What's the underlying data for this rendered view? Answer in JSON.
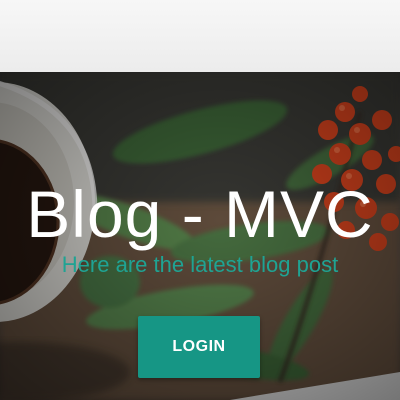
{
  "hero": {
    "title": "Blog - MVC",
    "subtitle": "Here are the latest blog post",
    "login_label": "LOGIN",
    "background_image": "coffee-cup-and-berries-photo"
  },
  "colors": {
    "accent": "#169685",
    "subtitle": "#1fa393",
    "title": "#ffffff"
  }
}
